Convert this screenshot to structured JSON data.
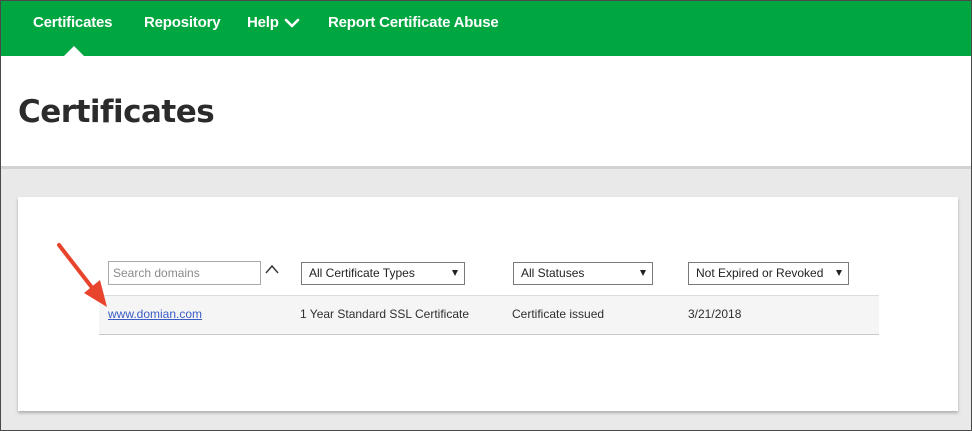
{
  "nav": {
    "items": [
      {
        "label": "Certificates"
      },
      {
        "label": "Repository"
      },
      {
        "label": "Help"
      },
      {
        "label": "Report Certificate Abuse"
      }
    ],
    "active": "Certificates",
    "help_icon": "chevron-down-icon",
    "color": "#00a63f"
  },
  "header": {
    "title": "Certificates"
  },
  "filters": {
    "search_placeholder": "Search domains",
    "sort_icon": "chevron-up-icon",
    "certificate_type": "All Certificate Types",
    "status": "All Statuses",
    "expiry": "Not Expired or Revoked"
  },
  "rows": [
    {
      "domain": "www.domian.com",
      "type": "1 Year Standard SSL Certificate",
      "status": "Certificate issued",
      "date": "3/21/2018"
    }
  ],
  "annotation": {
    "icon": "red-arrow-icon",
    "color": "#e8442d"
  }
}
